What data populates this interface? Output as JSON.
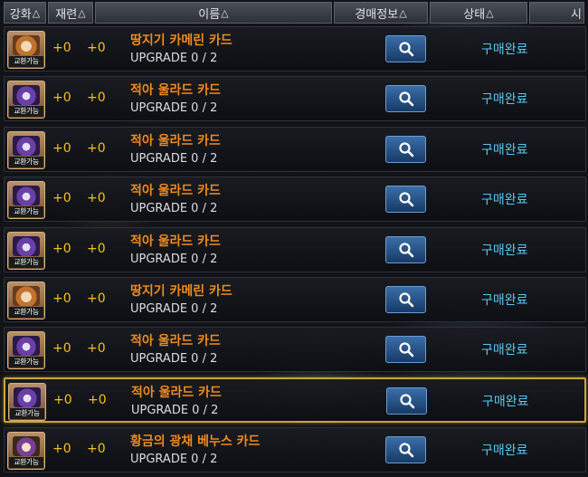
{
  "columns": [
    {
      "label": "강화",
      "arrow": "△"
    },
    {
      "label": "재련",
      "arrow": "△"
    },
    {
      "label": "이름",
      "arrow": "△"
    },
    {
      "label": "경매정보",
      "arrow": "△"
    },
    {
      "label": "상태",
      "arrow": "△"
    },
    {
      "label": "시",
      "arrow": ""
    }
  ],
  "icon_tag": "교환가능",
  "rows": [
    {
      "enhance": "+0",
      "refine": "+0",
      "name": "땅지기 카메린 카드",
      "upgrade": "UPGRADE 0 / 2",
      "status": "구매완료",
      "icon": "orange"
    },
    {
      "enhance": "+0",
      "refine": "+0",
      "name": "적아 울라드 카드",
      "upgrade": "UPGRADE 0 / 2",
      "status": "구매완료",
      "icon": "purple"
    },
    {
      "enhance": "+0",
      "refine": "+0",
      "name": "적아 울라드 카드",
      "upgrade": "UPGRADE 0 / 2",
      "status": "구매완료",
      "icon": "purple"
    },
    {
      "enhance": "+0",
      "refine": "+0",
      "name": "적아 울라드 카드",
      "upgrade": "UPGRADE 0 / 2",
      "status": "구매완료",
      "icon": "purple"
    },
    {
      "enhance": "+0",
      "refine": "+0",
      "name": "적아 울라드 카드",
      "upgrade": "UPGRADE 0 / 2",
      "status": "구매완료",
      "icon": "purple"
    },
    {
      "enhance": "+0",
      "refine": "+0",
      "name": "땅지기 카메린 카드",
      "upgrade": "UPGRADE 0 / 2",
      "status": "구매완료",
      "icon": "orange"
    },
    {
      "enhance": "+0",
      "refine": "+0",
      "name": "적아 울라드 카드",
      "upgrade": "UPGRADE 0 / 2",
      "status": "구매완료",
      "icon": "purple"
    },
    {
      "enhance": "+0",
      "refine": "+0",
      "name": "적아 울라드 카드",
      "upgrade": "UPGRADE 0 / 2",
      "status": "구매완료",
      "icon": "purple",
      "selected": true
    },
    {
      "enhance": "+0",
      "refine": "+0",
      "name": "황금의 광채 베누스 카드",
      "upgrade": "UPGRADE 0 / 2",
      "status": "구매완료",
      "icon": "gold"
    }
  ],
  "colors": {
    "name": "#f08a1c",
    "enhance": "#f2c21c",
    "status": "#59c8f0",
    "selected_border": "#c9a43a",
    "button": "#2a5690"
  },
  "search_button_icon": "magnifier-icon"
}
